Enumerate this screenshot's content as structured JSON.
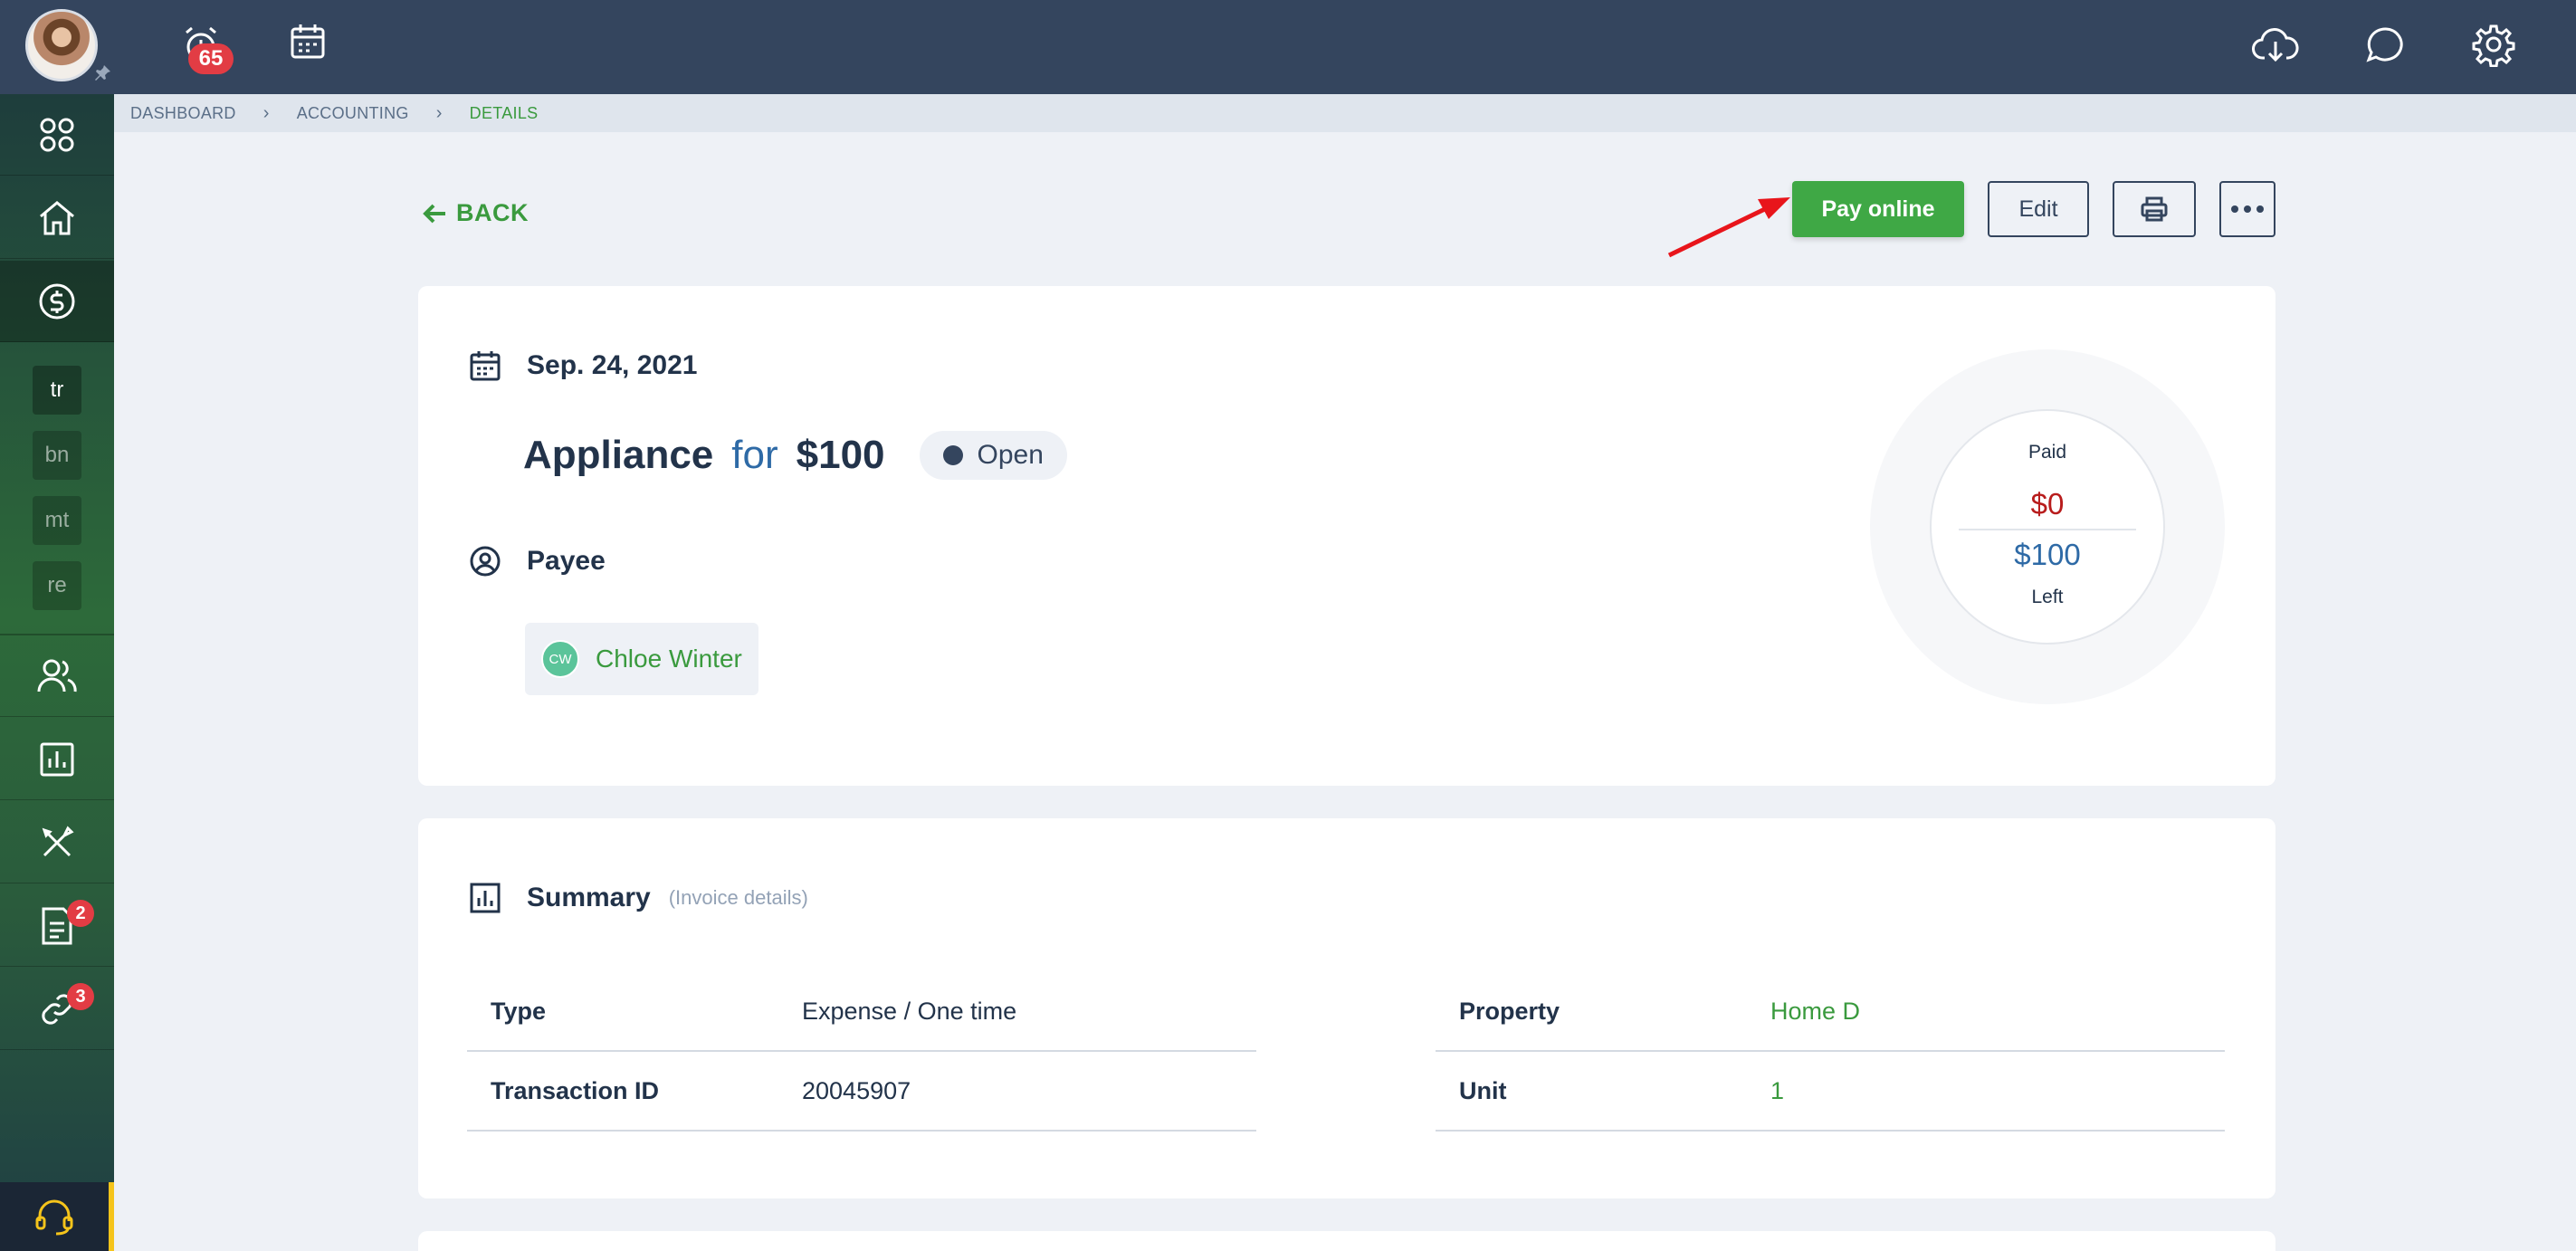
{
  "topbar": {
    "notifications_count": "65"
  },
  "sidebar": {
    "mini_items": [
      "tr",
      "bn",
      "mt",
      "re"
    ],
    "documents_badge": "2",
    "links_badge": "3"
  },
  "breadcrumb": {
    "items": [
      "DASHBOARD",
      "ACCOUNTING",
      "DETAILS"
    ]
  },
  "actions": {
    "back_label": "BACK",
    "pay_label": "Pay online",
    "edit_label": "Edit"
  },
  "transaction": {
    "date": "Sep. 24, 2021",
    "category": "Appliance",
    "for_word": "for",
    "amount": "$100",
    "status": "Open",
    "payee_label": "Payee",
    "payee_initials": "CW",
    "payee_name": "Chloe Winter"
  },
  "donut": {
    "paid_label": "Paid",
    "paid_value": "$0",
    "left_value": "$100",
    "left_label": "Left"
  },
  "summary": {
    "title": "Summary",
    "subtitle": "(Invoice details)",
    "left_rows": [
      {
        "key": "Type",
        "value": "Expense / One time"
      },
      {
        "key": "Transaction ID",
        "value": "20045907"
      }
    ],
    "right_rows": [
      {
        "key": "Property",
        "value": "Home D"
      },
      {
        "key": "Unit",
        "value": "1"
      }
    ]
  },
  "colors": {
    "primary_green": "#3fa845",
    "topbar": "#34455e",
    "alert_red": "#e23c44",
    "support_accent": "#f5c41b"
  }
}
